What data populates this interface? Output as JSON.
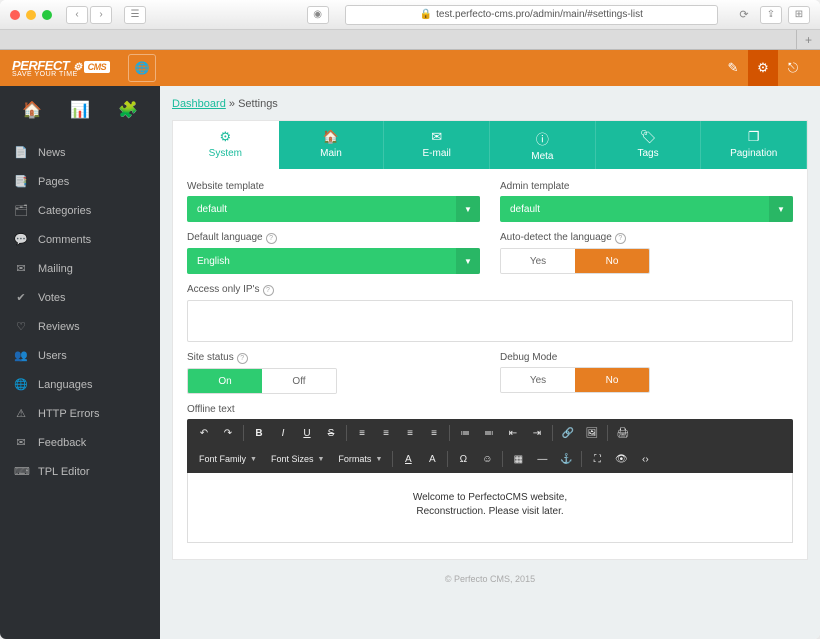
{
  "browser": {
    "url": "test.perfecto-cms.pro/admin/main/#settings-list"
  },
  "brand": {
    "name": "PERFECT",
    "sub": "SAVE YOUR TIME",
    "pill": "CMS"
  },
  "breadcrumb": {
    "root": "Dashboard",
    "sep": " » ",
    "current": "Settings"
  },
  "sidebar": {
    "items": [
      {
        "icon": "news",
        "label": "News"
      },
      {
        "icon": "pages",
        "label": "Pages"
      },
      {
        "icon": "categories",
        "label": "Categories"
      },
      {
        "icon": "comments",
        "label": "Comments"
      },
      {
        "icon": "mailing",
        "label": "Mailing"
      },
      {
        "icon": "votes",
        "label": "Votes"
      },
      {
        "icon": "reviews",
        "label": "Reviews"
      },
      {
        "icon": "users",
        "label": "Users"
      },
      {
        "icon": "languages",
        "label": "Languages"
      },
      {
        "icon": "errors",
        "label": "HTTP Errors"
      },
      {
        "icon": "feedback",
        "label": "Feedback"
      },
      {
        "icon": "tpl",
        "label": "TPL Editor"
      }
    ]
  },
  "tabs": [
    {
      "label": "System",
      "active": true
    },
    {
      "label": "Main"
    },
    {
      "label": "E-mail"
    },
    {
      "label": "Meta"
    },
    {
      "label": "Tags"
    },
    {
      "label": "Pagination"
    }
  ],
  "form": {
    "website_template": {
      "label": "Website template",
      "value": "default"
    },
    "admin_template": {
      "label": "Admin template",
      "value": "default"
    },
    "default_language": {
      "label": "Default language",
      "value": "English"
    },
    "autodetect": {
      "label": "Auto-detect the language",
      "yes": "Yes",
      "no": "No",
      "value": "No"
    },
    "access_ips": {
      "label": "Access only IP's"
    },
    "site_status": {
      "label": "Site status",
      "on": "On",
      "off": "Off",
      "value": "On"
    },
    "debug_mode": {
      "label": "Debug Mode",
      "yes": "Yes",
      "no": "No",
      "value": "No"
    },
    "offline_text": {
      "label": "Offline text"
    }
  },
  "editor": {
    "font_family": "Font Family",
    "font_sizes": "Font Sizes",
    "formats": "Formats",
    "content_line1": "Welcome to PerfectoCMS website,",
    "content_line2": "Reconstruction. Please visit later."
  },
  "footer": "© Perfecto CMS, 2015"
}
